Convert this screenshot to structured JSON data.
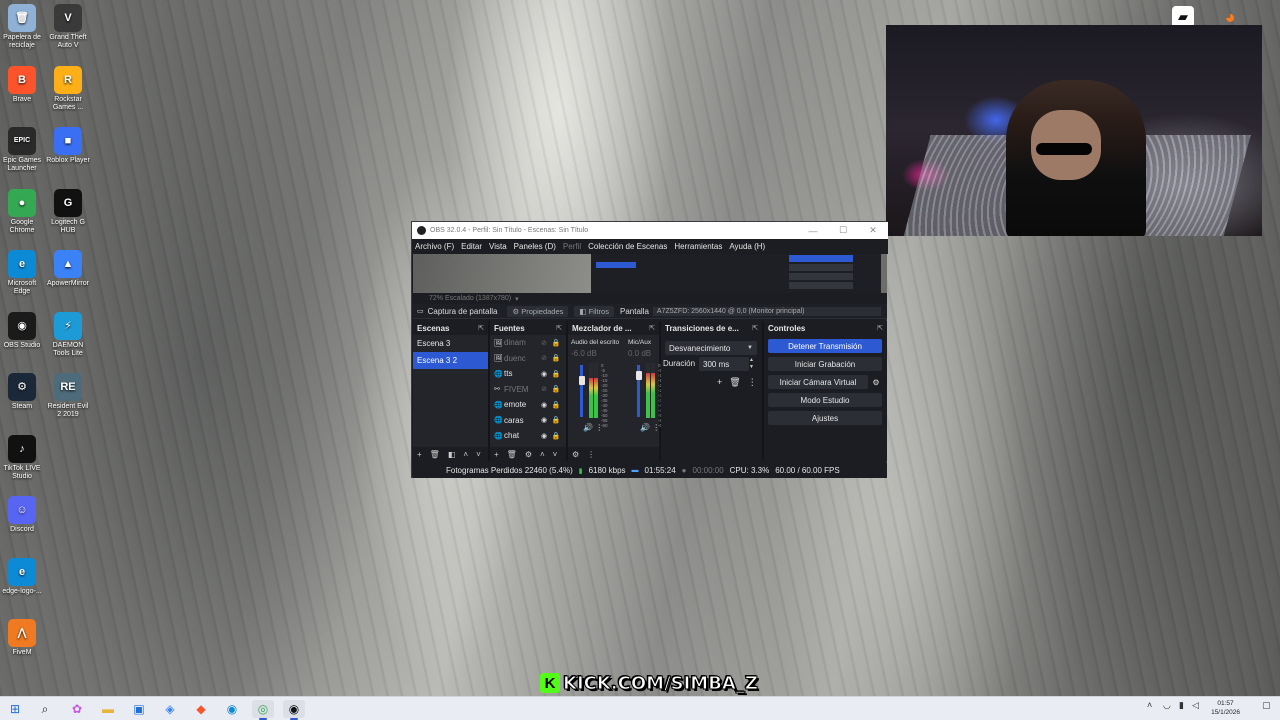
{
  "desktop": {
    "icons": [
      {
        "label": "Papelera de reciclaje",
        "icon": "recycle-bin-icon",
        "color": "#8fb1d6",
        "glyph": "🗑"
      },
      {
        "label": "Grand Theft Auto V",
        "icon": "gta-icon",
        "color": "#3a3a3a",
        "glyph": "V"
      },
      {
        "label": "Brave",
        "icon": "brave-icon",
        "color": "#fb542b",
        "glyph": "B"
      },
      {
        "label": "Rockstar Games ...",
        "icon": "rockstar-icon",
        "color": "#fcaf17",
        "glyph": "R"
      },
      {
        "label": "Epic Games Launcher",
        "icon": "epic-games-icon",
        "color": "#2a2a2a",
        "glyph": "EPIC"
      },
      {
        "label": "Roblox Player",
        "icon": "roblox-icon",
        "color": "#3a6ff3",
        "glyph": "■"
      },
      {
        "label": "Google Chrome",
        "icon": "chrome-icon",
        "color": "#34a853",
        "glyph": "●"
      },
      {
        "label": "Logitech G HUB",
        "icon": "logitech-icon",
        "color": "#111111",
        "glyph": "G"
      },
      {
        "label": "Microsoft Edge",
        "icon": "edge-icon",
        "color": "#0c8ad6",
        "glyph": "e"
      },
      {
        "label": "ApowerMirror",
        "icon": "apowermirror-icon",
        "color": "#3b82f6",
        "glyph": "▲"
      },
      {
        "label": "OBS Studio",
        "icon": "obs-icon",
        "color": "#1b1b1b",
        "glyph": "◉"
      },
      {
        "label": "DAEMON Tools Lite",
        "icon": "daemon-tools-icon",
        "color": "#1d9bd6",
        "glyph": "⚡"
      },
      {
        "label": "Steam",
        "icon": "steam-icon",
        "color": "#1b2838",
        "glyph": "⚙"
      },
      {
        "label": "Resident Evil 2 2019",
        "icon": "resident-evil-icon",
        "color": "#4d6b7a",
        "glyph": "RE"
      },
      {
        "label": "TikTok LIVE Studio",
        "icon": "tiktok-icon",
        "color": "#111111",
        "glyph": "♪"
      },
      {
        "label": "Discord",
        "icon": "discord-icon",
        "color": "#5865f2",
        "glyph": "☺"
      },
      {
        "label": "edge-logo-...",
        "icon": "edge-logo-icon",
        "color": "#0c8ad6",
        "glyph": "e"
      },
      {
        "label": "FiveM",
        "icon": "fivem-icon",
        "color": "#f07a21",
        "glyph": "⋀"
      }
    ]
  },
  "obs": {
    "title": "OBS 32.0.4 - Perfil: Sin Título - Escenas: Sin Título",
    "menu": [
      "Archivo (F)",
      "Editar",
      "Vista",
      "Paneles (D)",
      "Perfil",
      "Colección de Escenas",
      "Herramientas",
      "Ayuda (H)"
    ],
    "scale_text": "72%     Escalado (1387x780)",
    "source_bar": {
      "capture": "Captura de pantalla",
      "properties": "Propiedades",
      "filters": "Filtros",
      "display_label": "Pantalla",
      "display_value": "A7Z5ZFD: 2560x1440 @ 0,0 (Monitor principal)"
    },
    "scenes": {
      "title": "Escenas",
      "items": [
        {
          "name": "Escena 3",
          "active": false
        },
        {
          "name": "Escena 3 2",
          "active": true
        }
      ]
    },
    "sources": {
      "title": "Fuentes",
      "items": [
        {
          "name": "dinam",
          "visible": false,
          "icon": "🖼"
        },
        {
          "name": "duenc",
          "visible": false,
          "icon": "🖼"
        },
        {
          "name": "tts",
          "visible": true,
          "icon": "🌐"
        },
        {
          "name": "FIVEM",
          "visible": false,
          "icon": "⚯"
        },
        {
          "name": "emote",
          "visible": true,
          "icon": "🌐"
        },
        {
          "name": "caras",
          "visible": true,
          "icon": "🌐"
        },
        {
          "name": "chat",
          "visible": true,
          "icon": "🌐"
        }
      ]
    },
    "mixer": {
      "title": "Mezclador de ...",
      "channels": [
        {
          "name": "Audio del escrito",
          "db": "-6.0 dB",
          "level": 0.9
        },
        {
          "name": "Mic/Aux",
          "db": "0.0 dB",
          "level": 1.0
        }
      ],
      "ticks": [
        "0",
        "-5",
        "-10",
        "-15",
        "-20",
        "-25",
        "-30",
        "-35",
        "-40",
        "-45",
        "-50",
        "-55",
        "-60"
      ]
    },
    "transitions": {
      "title": "Transiciones de e...",
      "selected": "Desvanecimiento",
      "duration_label": "Duración",
      "duration_value": "300 ms"
    },
    "controls": {
      "title": "Controles",
      "buttons": [
        "Detener Transmisión",
        "Iniciar Grabación",
        "Iniciar Cámara Virtual",
        "Modo Estudio",
        "Ajustes"
      ]
    },
    "status": {
      "dropped_frames": "Fotogramas Perdidos 22460 (5.4%)",
      "bitrate": "6180 kbps",
      "live_time": "01:55:24",
      "rec_time": "00:00:00",
      "cpu": "CPU: 3.3%",
      "fps": "60.00 / 60.00 FPS"
    }
  },
  "overlay": {
    "kick_text": "KICK.COM/SIMBA_Z",
    "kick_color": "#53fc18"
  },
  "taskbar": {
    "clock_time": "01:57",
    "clock_date": "15/1/2026"
  }
}
